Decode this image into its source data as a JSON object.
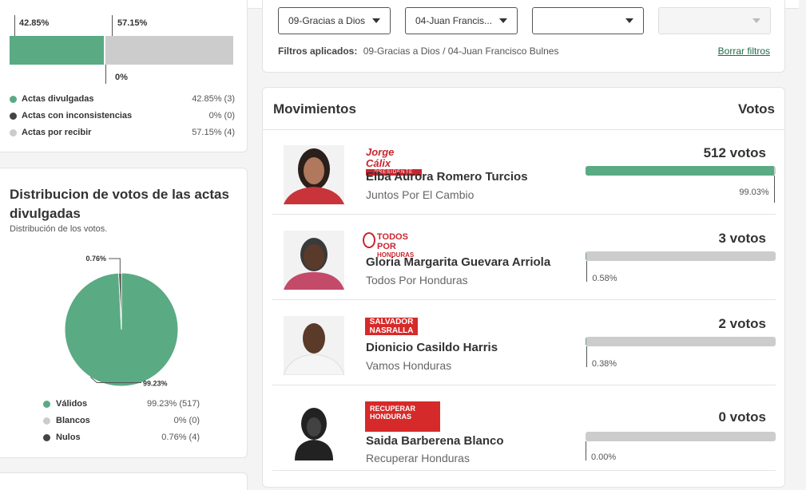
{
  "actas": {
    "bar_left_pct_label": "42.85%",
    "bar_right_pct_label": "57.15%",
    "bar_zero_label": "0%",
    "divulgadas_fraction": 0.4285,
    "legend": [
      {
        "label": "Actas divulgadas",
        "value": "42.85% (3)",
        "color": "#5aaa84"
      },
      {
        "label": "Actas con inconsistencias",
        "value": "0% (0)",
        "color": "#444444"
      },
      {
        "label": "Actas por recibir",
        "value": "57.15% (4)",
        "color": "#cccccc"
      }
    ]
  },
  "distribucion": {
    "title": "Distribucion de votos de las actas divulgadas",
    "subtitle": "Distribución de los votos.",
    "legend": [
      {
        "label": "Válidos",
        "value": "99.23% (517)",
        "color": "#5aaa84"
      },
      {
        "label": "Blancos",
        "value": "0% (0)",
        "color": "#cccccc"
      },
      {
        "label": "Nulos",
        "value": "0.76% (4)",
        "color": "#444444"
      }
    ]
  },
  "chart_data": {
    "type": "pie",
    "categories": [
      "Válidos",
      "Blancos",
      "Nulos"
    ],
    "values": [
      99.23,
      0,
      0.76
    ],
    "data_labels": [
      "99.23%",
      "0.76%"
    ],
    "colors": [
      "#5aaa84",
      "#cccccc",
      "#444444"
    ]
  },
  "filters": {
    "selects": [
      {
        "value": "09-Gracias a Dios",
        "disabled": false
      },
      {
        "value": "04-Juan Francis...",
        "disabled": false
      },
      {
        "value": "",
        "disabled": false
      },
      {
        "value": "",
        "disabled": true
      }
    ],
    "applied_label": "Filtros aplicados:",
    "applied_value": "09-Gracias a Dios / 04-Juan Francisco Bulnes",
    "clear_link": "Borrar filtros"
  },
  "movimientos": {
    "title": "Movimientos",
    "votes_header": "Votos",
    "candidates": [
      {
        "name": "Elba Aurora Romero Turcios",
        "party": "Juntos Por El Cambio",
        "votes": "512 votos",
        "pct": "99.03%",
        "fraction": 0.9903,
        "logo_text": "Jorge Cálix",
        "logo_sub": "PRESIDENTE"
      },
      {
        "name": "Gloria Margarita Guevara Arriola",
        "party": "Todos Por Honduras",
        "votes": "3 votos",
        "pct": "0.58%",
        "fraction": 0.0058,
        "logo_text": "TODOS POR",
        "logo_sub": "HONDURAS"
      },
      {
        "name": "Dionicio Casildo Harris",
        "party": "Vamos Honduras",
        "votes": "2 votos",
        "pct": "0.38%",
        "fraction": 0.0038,
        "logo_text": "SALVADOR",
        "logo_sub": "NASRALLA"
      },
      {
        "name": "Saida Barberena Blanco",
        "party": "Recuperar Honduras",
        "votes": "0 votos",
        "pct": "0.00%",
        "fraction": 0.0,
        "logo_text": "RECUPERAR",
        "logo_sub": "HONDURAS"
      }
    ]
  }
}
